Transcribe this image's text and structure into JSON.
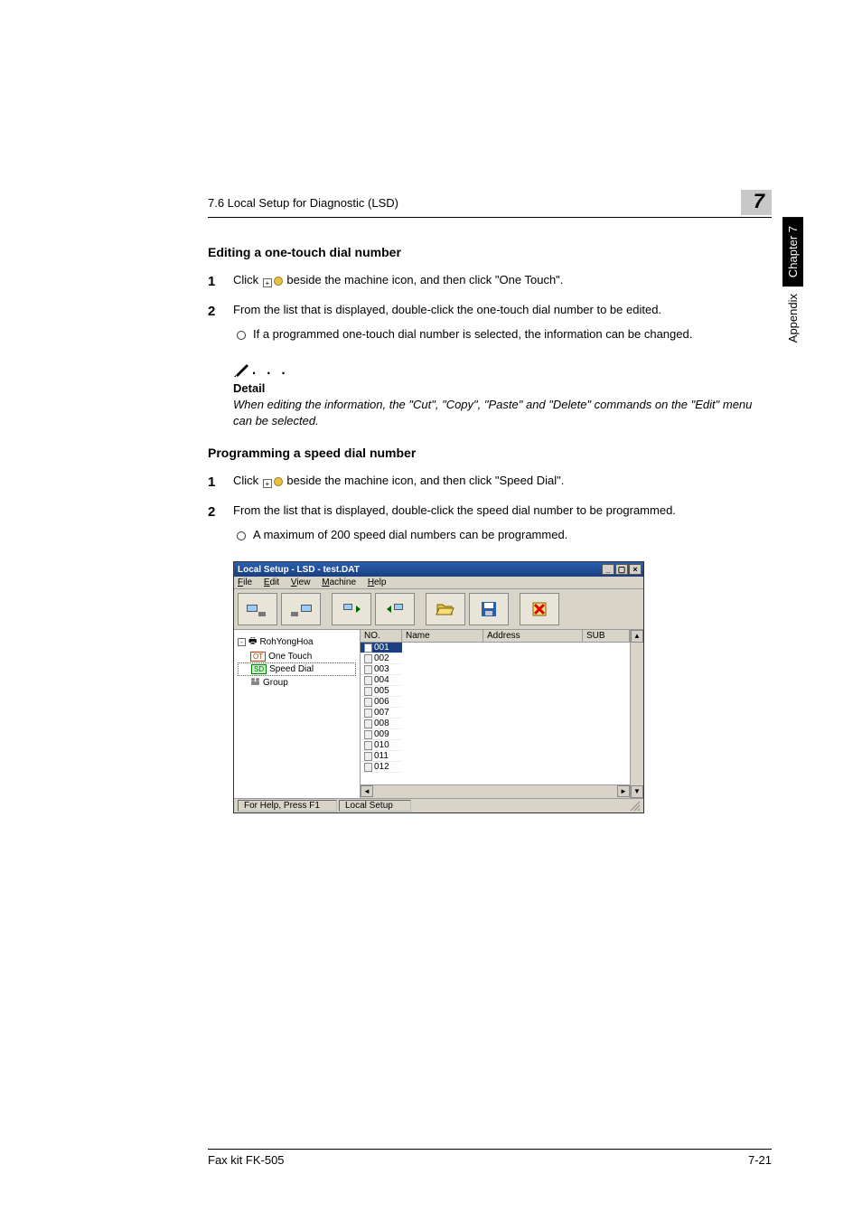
{
  "header": {
    "section": "7.6 Local Setup for Diagnostic (LSD)",
    "chapter_num": "7"
  },
  "side": {
    "chapter": "Chapter 7",
    "appendix": "Appendix"
  },
  "section1": {
    "title": "Editing a one-touch dial number",
    "step1a": "Click ",
    "step1b": " beside the machine icon, and then click \"One Touch\".",
    "step2": "From the list that is displayed, double-click the one-touch dial number to be edited.",
    "step2_bullet": "If a programmed one-touch dial number is selected, the information can be changed."
  },
  "note": {
    "head": "Detail",
    "body": "When editing the information, the \"Cut\", \"Copy\", \"Paste\" and \"Delete\" commands on the \"Edit\" menu can be selected."
  },
  "section2": {
    "title": "Programming a speed dial number",
    "step1a": "Click ",
    "step1b": " beside the machine icon, and then click \"Speed Dial\".",
    "step2": "From the list that is displayed, double-click the speed dial number to be programmed.",
    "step2_bullet": "A maximum of 200 speed dial numbers can be programmed."
  },
  "screenshot": {
    "title": "Local Setup - LSD - test.DAT",
    "menu": {
      "file": "File",
      "edit": "Edit",
      "view": "View",
      "machine": "Machine",
      "help": "Help"
    },
    "toolbar_icons": [
      "connect-from-icon",
      "connect-to-icon",
      "upload-icon",
      "download-icon",
      "open-icon",
      "save-icon",
      "delete-icon"
    ],
    "tree": {
      "root": "RohYongHoa",
      "items": [
        "One Touch",
        "Speed Dial",
        "Group"
      ]
    },
    "columns": {
      "no": "NO.",
      "name": "Name",
      "address": "Address",
      "sub": "SUB"
    },
    "rows": [
      "001",
      "002",
      "003",
      "004",
      "005",
      "006",
      "007",
      "008",
      "009",
      "010",
      "011",
      "012"
    ],
    "selected_row": "001",
    "status": {
      "help": "For Help, Press F1",
      "mode": "Local Setup"
    }
  },
  "footer": {
    "left": "Fax kit FK-505",
    "right": "7-21"
  }
}
